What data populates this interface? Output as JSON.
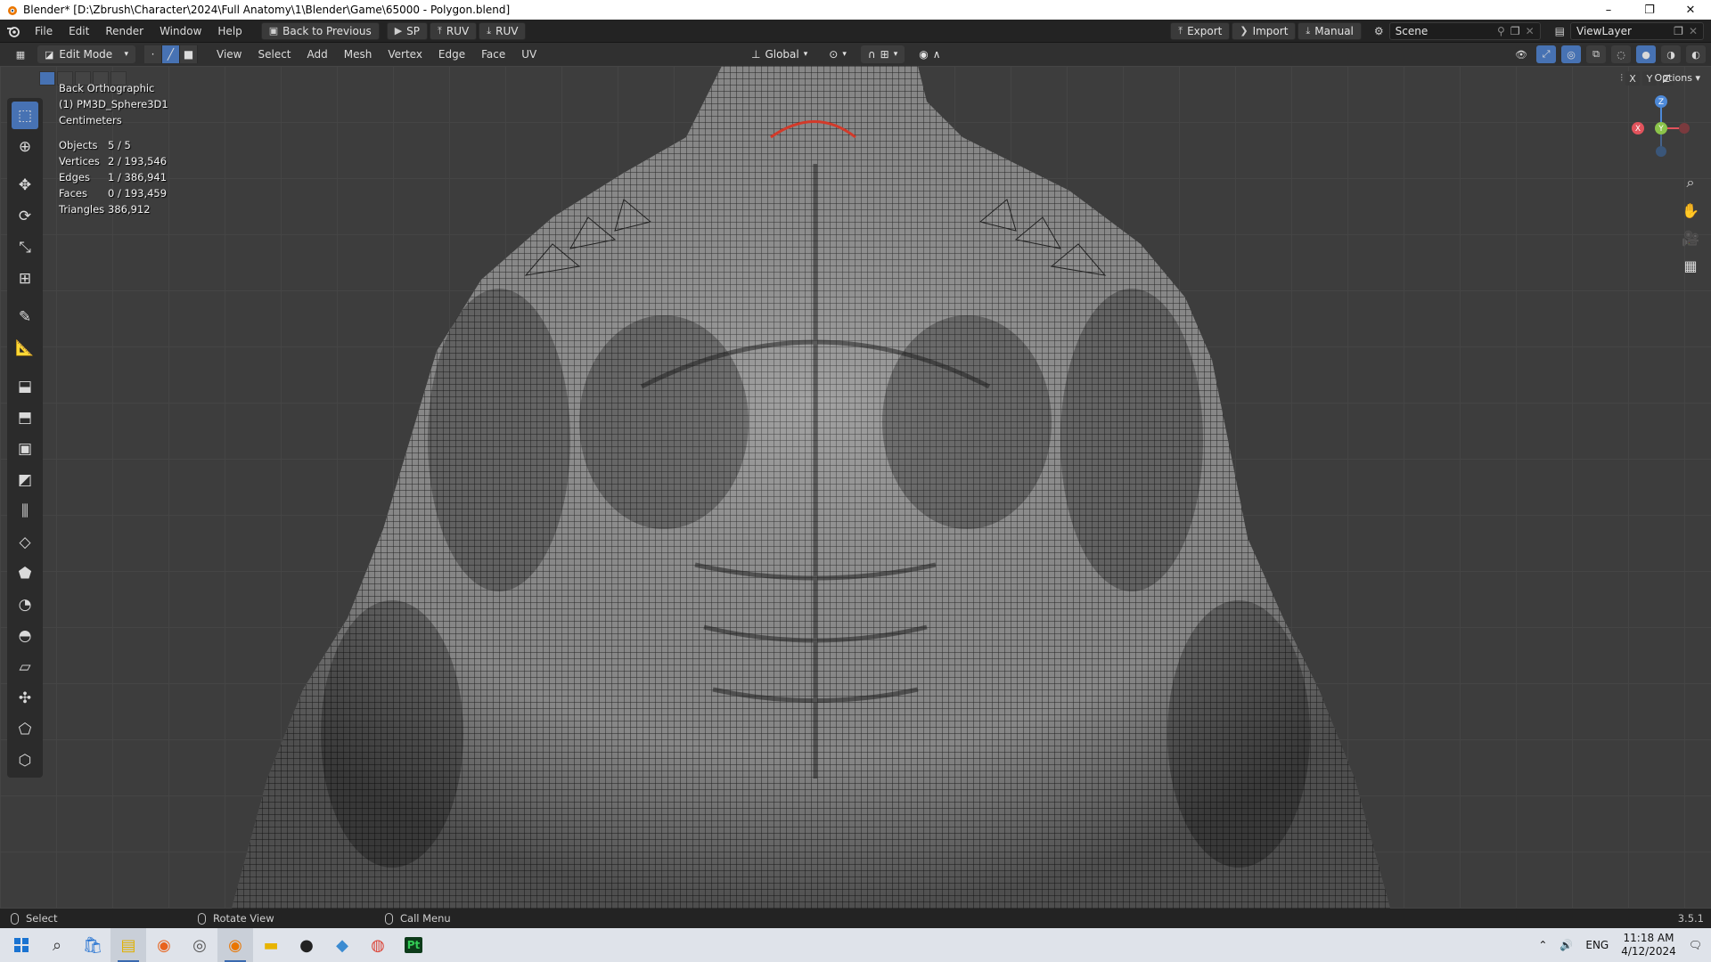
{
  "window": {
    "title": "Blender* [D:\\Zbrush\\Character\\2024\\Full Anatomy\\1\\Blender\\Game\\65000 - Polygon.blend]",
    "minimize": "–",
    "restore": "❐",
    "close": "✕"
  },
  "topbar": {
    "menus": [
      "File",
      "Edit",
      "Render",
      "Window",
      "Help"
    ],
    "back_label": "Back to Previous",
    "sp_label": "SP",
    "ruv1_label": "RUV",
    "ruv2_label": "RUV",
    "export_label": "Export",
    "import_label": "Import",
    "manual_label": "Manual",
    "scene_label": "Scene",
    "viewlayer_label": "ViewLayer"
  },
  "viewport_header": {
    "mode": "Edit Mode",
    "menus": [
      "View",
      "Select",
      "Add",
      "Mesh",
      "Vertex",
      "Edge",
      "Face",
      "UV"
    ],
    "orientation": "Global"
  },
  "overlay": {
    "view_name": "Back Orthographic",
    "object_name": "(1) PM3D_Sphere3D1",
    "units": "Centimeters",
    "stats": [
      {
        "label": "Objects",
        "value": "5 / 5"
      },
      {
        "label": "Vertices",
        "value": "2 / 193,546"
      },
      {
        "label": "Edges",
        "value": "1 / 386,941"
      },
      {
        "label": "Faces",
        "value": "0 / 193,459"
      },
      {
        "label": "Triangles",
        "value": "386,912"
      }
    ]
  },
  "axis_lock": {
    "x": "X",
    "y": "Y",
    "z": "Z",
    "options": "Options"
  },
  "gizmo": {
    "z": "Z",
    "y": "Y",
    "x": "X"
  },
  "statusbar": {
    "select": "Select",
    "rotate": "Rotate View",
    "call_menu": "Call Menu",
    "version": "3.5.1"
  },
  "taskbar": {
    "lang": "ENG",
    "time": "11:18 AM",
    "date": "4/12/2024",
    "app_pt": "Pt"
  },
  "colors": {
    "accent": "#4772b3",
    "x_axis": "#e2535c",
    "y_axis": "#8bc34a",
    "z_axis": "#4d89d8"
  }
}
